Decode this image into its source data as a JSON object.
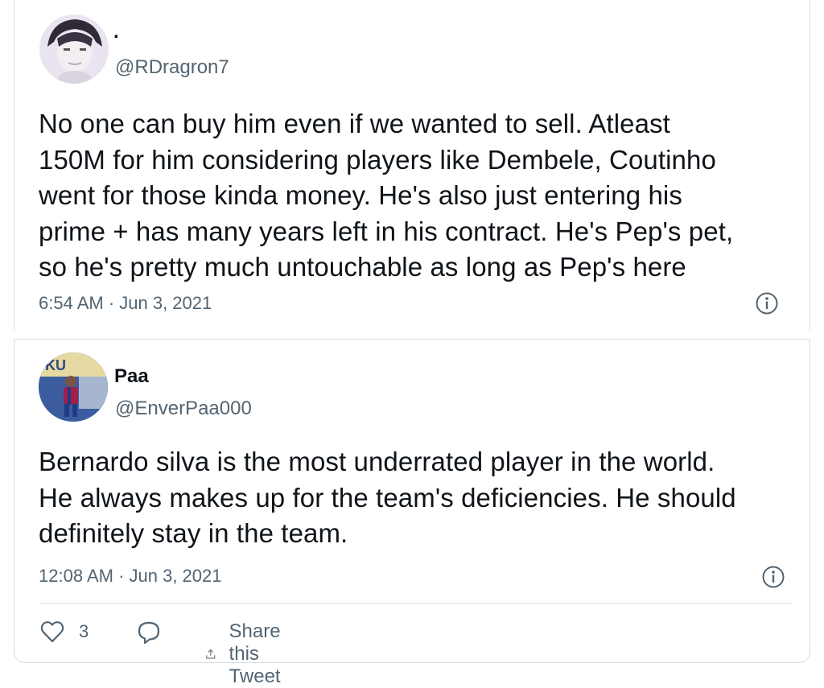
{
  "tweets": [
    {
      "display_name": ".",
      "handle": "@RDragron7",
      "body_lines": [
        "No one can buy him even if we wanted to sell. Atleast",
        "150M for him considering players like Dembele, Coutinho",
        "went for those kinda money. He's also just entering his",
        "prime + has many years left in his contract. He's Pep's pet,",
        "so he's pretty much untouchable as long as Pep's here"
      ],
      "timestamp": "6:54 AM · Jun 3, 2021",
      "avatar_icon": "anime-avatar-icon"
    },
    {
      "display_name": "Paa",
      "handle": "@EnverPaa000",
      "body_lines": [
        "Bernardo silva is the most underrated player in the world.",
        "He always makes up for the team's deficiencies. He should",
        "definitely stay in the team."
      ],
      "timestamp": "12:08 AM · Jun 3, 2021",
      "avatar_icon": "football-player-avatar-icon",
      "avatar_banner_text": "KU"
    }
  ],
  "actions": {
    "like_count": "3",
    "share_label": "Share this Tweet"
  },
  "colors": {
    "text": "#0f1419",
    "muted": "#536471",
    "border": "#d8dde2"
  }
}
